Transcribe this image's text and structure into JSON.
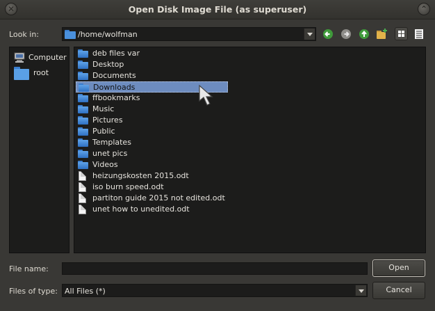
{
  "window": {
    "title": "Open Disk Image File (as superuser)"
  },
  "look_in": {
    "label": "Look in:",
    "value": "/home/wolfman"
  },
  "toolbar": {
    "back": "back-arrow",
    "forward": "forward-arrow",
    "up": "up-arrow",
    "new_folder": "new-folder",
    "icon_view": "icon-view",
    "detail_view": "detail-view"
  },
  "places": [
    {
      "label": "Computer",
      "icon": "computer-icon"
    },
    {
      "label": "root",
      "icon": "folder-icon"
    }
  ],
  "files": [
    {
      "name": "deb files var",
      "type": "folder"
    },
    {
      "name": "Desktop",
      "type": "folder"
    },
    {
      "name": "Documents",
      "type": "folder"
    },
    {
      "name": "Downloads",
      "type": "folder",
      "selected": true
    },
    {
      "name": "ffbookmarks",
      "type": "folder"
    },
    {
      "name": "Music",
      "type": "folder"
    },
    {
      "name": "Pictures",
      "type": "folder"
    },
    {
      "name": "Public",
      "type": "folder"
    },
    {
      "name": "Templates",
      "type": "folder"
    },
    {
      "name": "unet pics",
      "type": "folder"
    },
    {
      "name": "Videos",
      "type": "folder"
    },
    {
      "name": "heizungskosten 2015.odt",
      "type": "file"
    },
    {
      "name": "iso burn speed.odt",
      "type": "file"
    },
    {
      "name": "partiton guide 2015 not edited.odt",
      "type": "file"
    },
    {
      "name": "unet how to unedited.odt",
      "type": "file"
    }
  ],
  "file_name": {
    "label": "File name:",
    "value": ""
  },
  "files_of_type": {
    "label": "Files of type:",
    "value": "All Files (*)"
  },
  "buttons": {
    "open": "Open",
    "cancel": "Cancel"
  },
  "colors": {
    "accent_selected": "#6d8cbf",
    "nav_green": "#4caf50"
  }
}
